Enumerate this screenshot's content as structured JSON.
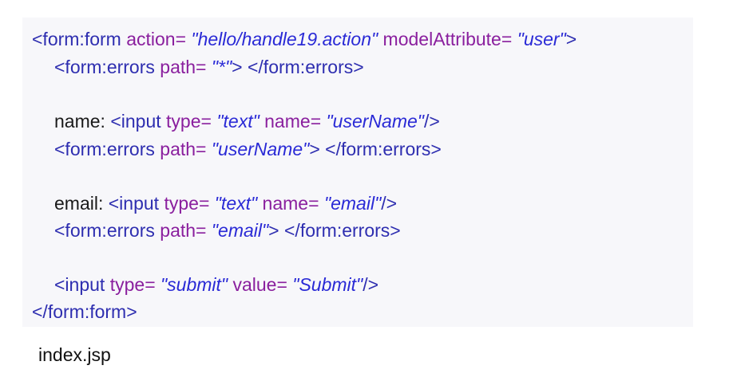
{
  "code": {
    "line1": {
      "open": "<form:form ",
      "attr1": "action",
      "eq1": "= ",
      "val1": "\"hello/handle19.action\"",
      "attr2": " modelAttribute",
      "eq2": "= ",
      "val2": "\"user\"",
      "close": ">"
    },
    "line2": {
      "open": "<form:errors ",
      "attr1": "path",
      "eq1": "= ",
      "val1": "\"*\"",
      "close": "> </form:errors>"
    },
    "line3": {
      "label": "name: ",
      "open": "<input ",
      "attr1": "type",
      "eq1": "= ",
      "val1": "\"text\"",
      "attr2": " name",
      "eq2": "= ",
      "val2": "\"userName\"",
      "close": "/>"
    },
    "line4": {
      "open": "<form:errors ",
      "attr1": "path",
      "eq1": "= ",
      "val1": "\"userName\"",
      "close": "> </form:errors>"
    },
    "line5": {
      "label": "email: ",
      "open": "<input ",
      "attr1": "type",
      "eq1": "= ",
      "val1": "\"text\"",
      "attr2": " name",
      "eq2": "= ",
      "val2": "\"email\"",
      "close": "/>"
    },
    "line6": {
      "open": "<form:errors ",
      "attr1": "path",
      "eq1": "= ",
      "val1": "\"email\"",
      "close": "> </form:errors>"
    },
    "line7": {
      "open": "<input ",
      "attr1": "type",
      "eq1": "= ",
      "val1": "\"submit\"",
      "attr2": " value",
      "eq2": "= ",
      "val2": "\"Submit\"",
      "close": "/>"
    },
    "line8": {
      "close": "</form:form>"
    }
  },
  "caption": "index.jsp"
}
